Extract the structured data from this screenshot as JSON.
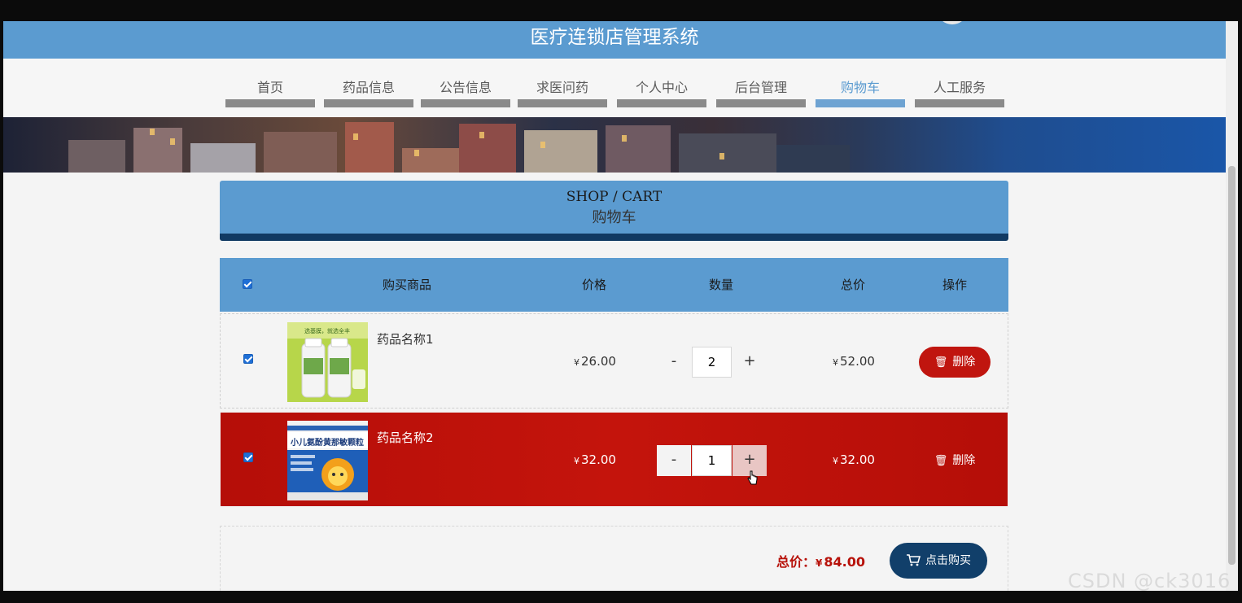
{
  "header": {
    "title": "医疗连锁店管理系统"
  },
  "nav": {
    "items": [
      {
        "label": "首页"
      },
      {
        "label": "药品信息"
      },
      {
        "label": "公告信息"
      },
      {
        "label": "求医问药"
      },
      {
        "label": "个人中心"
      },
      {
        "label": "后台管理"
      },
      {
        "label": "购物车"
      },
      {
        "label": "人工服务"
      }
    ],
    "active_index": 6
  },
  "cart_title": {
    "en": "SHOP / CART",
    "cn": "购物车"
  },
  "table": {
    "headers": {
      "product": "购买商品",
      "price": "价格",
      "quantity": "数量",
      "total": "总价",
      "action": "操作"
    },
    "rows": [
      {
        "checked": true,
        "name": "药品名称1",
        "image_text": "选基膜，就选全丰",
        "currency": "¥",
        "price": "26.00",
        "minus": "-",
        "quantity": "2",
        "plus": "+",
        "total": "52.00",
        "delete_label": "删除"
      },
      {
        "checked": true,
        "name": "药品名称2",
        "image_text": "小儿氨酚黄那敏颗粒",
        "currency": "¥",
        "price": "32.00",
        "minus": "-",
        "quantity": "1",
        "plus": "+",
        "total": "32.00",
        "delete_label": "删除"
      }
    ]
  },
  "summary": {
    "label": "总价：",
    "currency": "¥",
    "amount": "84.00",
    "buy_label": "点击购买"
  },
  "watermark": "CSDN @ck3016",
  "colors": {
    "primary": "#5b9bd0",
    "dark_blue": "#113f6a",
    "red": "#b71109",
    "selected_row": "#c4140c"
  }
}
